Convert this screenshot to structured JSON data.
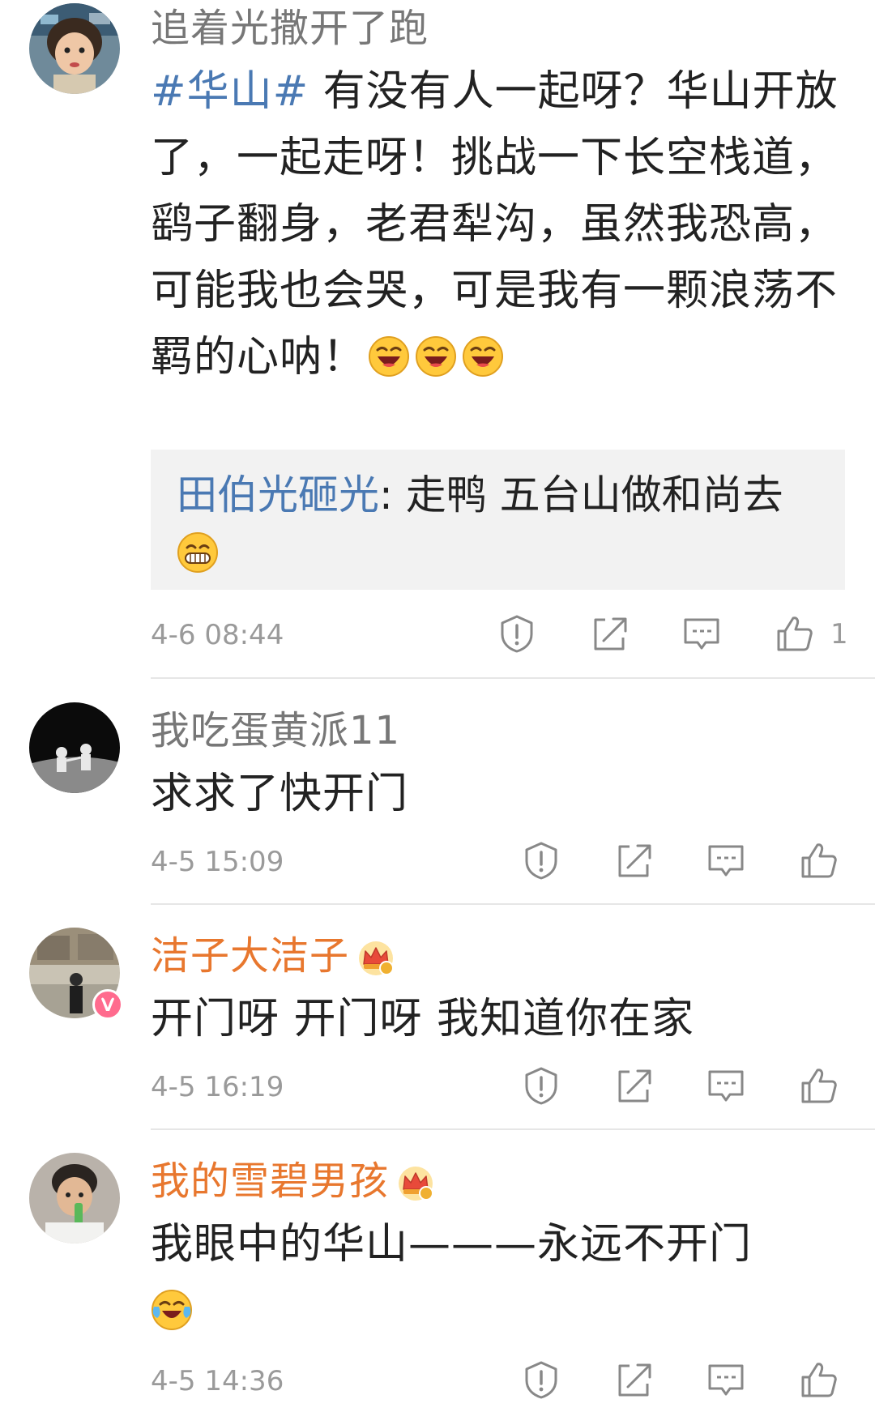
{
  "comments": [
    {
      "username": "追着光撒开了跑",
      "hashtag": "#华山#",
      "text": " 有没有人一起呀？华山开放了，一起走呀！挑战一下长空栈道，鹞子翻身，老君犁沟，虽然我恐高，可能我也会哭，可是我有一颗浪荡不羁的心呐！",
      "emojis": [
        "laughing-emoji",
        "laughing-emoji",
        "laughing-emoji"
      ],
      "reply": {
        "name": "田伯光砸光",
        "separator": ": ",
        "text": "走鸭   五台山做和尚去",
        "emoji": "grin-emoji"
      },
      "time": "4-6 08:44",
      "likes": "1"
    },
    {
      "username": "我吃蛋黄派11",
      "text": "求求了快开门",
      "time": "4-5 15:09",
      "likes": ""
    },
    {
      "username": "洁子大洁子",
      "username_color": "#e8772e",
      "crown_level": "6",
      "text": "开门呀 开门呀 我知道你在家",
      "time": "4-5 16:19",
      "likes": ""
    },
    {
      "username": "我的雪碧男孩",
      "username_color": "#e8772e",
      "crown_level": "4",
      "text": "我眼中的华山———永远不开门",
      "emojis": [
        "tears-of-joy-emoji"
      ],
      "time": "4-5 14:36",
      "likes": ""
    }
  ],
  "colors": {
    "link": "#4a79b3",
    "vip_name": "#e8772e",
    "meta": "#9a9a9a",
    "reply_bg": "#f2f2f2"
  }
}
